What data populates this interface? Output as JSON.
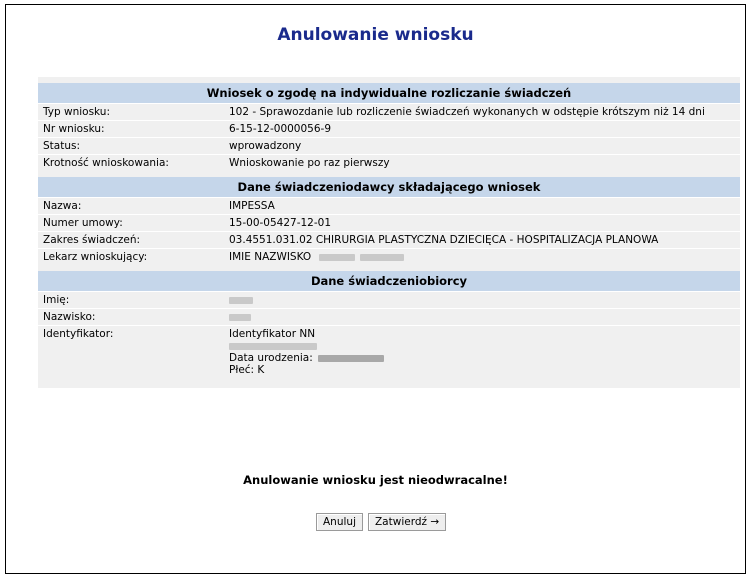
{
  "page": {
    "title": "Anulowanie wniosku"
  },
  "section1": {
    "header": "Wniosek o zgodę na indywidualne rozliczanie świadczeń",
    "rows": [
      {
        "label": "Typ wniosku:",
        "value": "102 - Sprawozdanie lub rozliczenie świadczeń wykonanych w odstępie krótszym niż 14 dni"
      },
      {
        "label": "Nr wniosku:",
        "value": "6-15-12-0000056-9"
      },
      {
        "label": "Status:",
        "value": "wprowadzony"
      },
      {
        "label": "Krotność wnioskowania:",
        "value": "Wnioskowanie po raz pierwszy"
      }
    ]
  },
  "section2": {
    "header": "Dane świadczeniodawcy składającego wniosek",
    "rows": [
      {
        "label": "Nazwa:",
        "value": "IMPESSA"
      },
      {
        "label": "Numer umowy:",
        "value": "15-00-05427-12-01"
      },
      {
        "label": "Zakres świadczeń:",
        "value": "03.4551.031.02 CHIRURGIA PLASTYCZNA DZIECIĘCA - HOSPITALIZACJA PLANOWA"
      },
      {
        "label": "Lekarz wnioskujący:",
        "value": "IMIE NAZWISKO"
      }
    ]
  },
  "section3": {
    "header": "Dane świadczeniobiorcy",
    "rows": [
      {
        "label": "Imię:"
      },
      {
        "label": "Nazwisko:"
      },
      {
        "label": "Identyfikator:",
        "id_type": "Identyfikator NN",
        "dob_label": "Data urodzenia:",
        "sex": "Płeć: K"
      }
    ]
  },
  "warning": "Anulowanie wniosku jest nieodwracalne!",
  "buttons": {
    "cancel": "Anuluj",
    "confirm": "Zatwierdź →"
  }
}
